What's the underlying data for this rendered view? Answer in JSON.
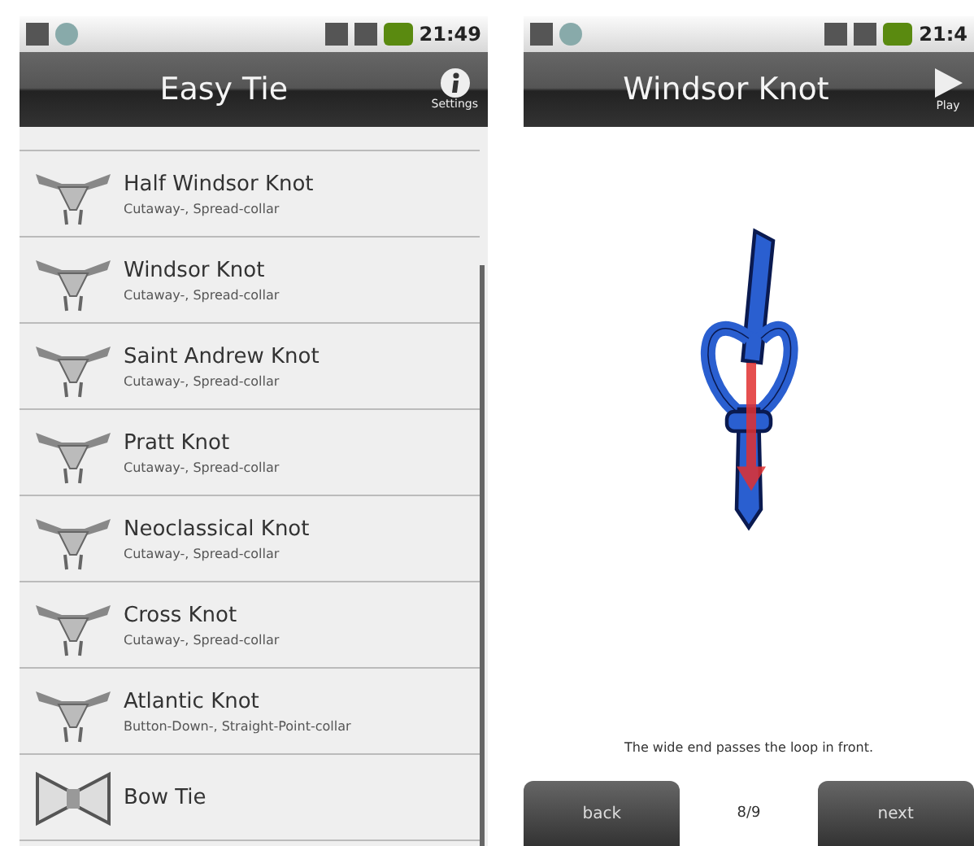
{
  "list_screen": {
    "status_bar": {
      "time": "21:49"
    },
    "header": {
      "title": "Easy Tie",
      "settings_label": "Settings"
    },
    "knots": [
      {
        "name": "Half Windsor Knot",
        "collars": "Cutaway-, Spread-collar"
      },
      {
        "name": "Windsor Knot",
        "collars": "Cutaway-, Spread-collar"
      },
      {
        "name": "Saint Andrew Knot",
        "collars": "Cutaway-, Spread-collar"
      },
      {
        "name": "Pratt Knot",
        "collars": "Cutaway-, Spread-collar"
      },
      {
        "name": "Neoclassical Knot",
        "collars": "Cutaway-, Spread-collar"
      },
      {
        "name": "Cross Knot",
        "collars": "Cutaway-, Spread-collar"
      },
      {
        "name": "Atlantic Knot",
        "collars": "Button-Down-, Straight-Point-collar"
      },
      {
        "name": "Bow Tie",
        "kind": "bow"
      }
    ]
  },
  "step_screen": {
    "status_bar": {
      "time": "21:4"
    },
    "header": {
      "title": "Windsor Knot",
      "play_label": "Play"
    },
    "caption": "The wide end passes the loop in front.",
    "nav": {
      "back": "back",
      "page": "8/9",
      "next": "next"
    }
  }
}
